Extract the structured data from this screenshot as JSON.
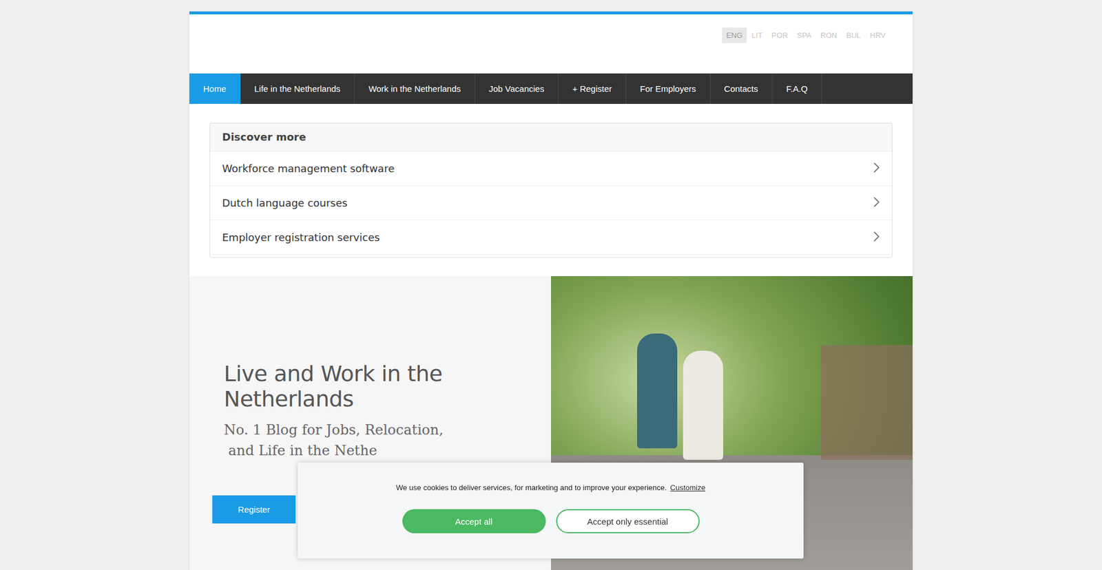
{
  "languages": [
    {
      "label": "ENG",
      "selected": true
    },
    {
      "label": "LIT",
      "selected": false
    },
    {
      "label": "POR",
      "selected": false
    },
    {
      "label": "SPA",
      "selected": false
    },
    {
      "label": "RON",
      "selected": false
    },
    {
      "label": "BUL",
      "selected": false
    },
    {
      "label": "HRV",
      "selected": false
    }
  ],
  "nav": [
    {
      "label": "Home",
      "selected": true
    },
    {
      "label": "Life in the Netherlands",
      "selected": false
    },
    {
      "label": "Work in the Netherlands",
      "selected": false
    },
    {
      "label": "Job Vacancies",
      "selected": false
    },
    {
      "label": "+ Register",
      "selected": false
    },
    {
      "label": "For Employers",
      "selected": false
    },
    {
      "label": "Contacts",
      "selected": false
    },
    {
      "label": "F.A.Q",
      "selected": false
    }
  ],
  "discover": {
    "title": "Discover more",
    "items": [
      "Workforce management software",
      "Dutch language courses",
      "Employer registration services"
    ]
  },
  "hero": {
    "title": "Live and Work in the Netherlands",
    "subtitle_lines": [
      "No. 1 Blog for Jobs, Relocation,",
      " and Life in the Nethe"
    ],
    "register": "Register"
  },
  "cookie": {
    "text": "We use cookies to deliver services, for marketing and to improve your experience.",
    "customize": "Customize",
    "buttons": [
      {
        "label": "Accept all",
        "kind": "filled"
      },
      {
        "label": "Accept only essential",
        "kind": "outline"
      }
    ]
  }
}
